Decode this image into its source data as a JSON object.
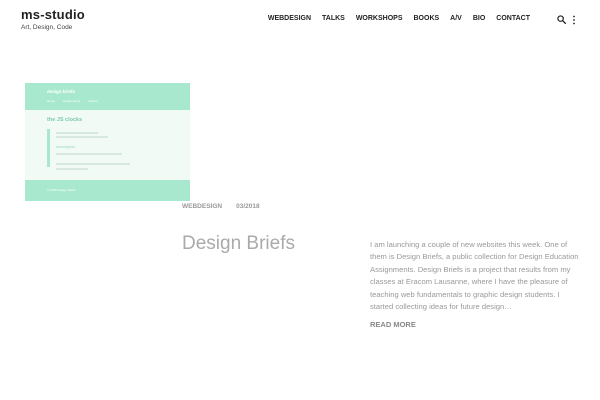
{
  "site": {
    "title": "ms-studio",
    "tagline": "Art, Design, Code"
  },
  "nav": {
    "items": [
      "WEBDESIGN",
      "TALKS",
      "WORKSHOPS",
      "BOOKS",
      "A/V",
      "BIO",
      "CONTACT"
    ]
  },
  "icons": {
    "search": "search-icon",
    "more": "more-vertical-icon"
  },
  "thumbnail": {
    "title": "design briefs",
    "nav": [
      "Home",
      "Assignments",
      "Submit"
    ],
    "heading": "the JS clocks",
    "description_label": "description",
    "footer": "© 2018 Design Briefs",
    "accent": "#a8e8cf"
  },
  "post": {
    "category": "WEBDESIGN",
    "date": "03/2018",
    "title": "Design Briefs",
    "excerpt": "I am launching a couple of new websites this week. One of them is Design Briefs, a public collection for Design Education Assignments. Design Briefs is a project that results from my classes at Eracom Lausanne, where I have the pleasure of teaching web fundamentals to graphic design students. I started collecting ideas for future design…",
    "read_more": "READ MORE"
  }
}
